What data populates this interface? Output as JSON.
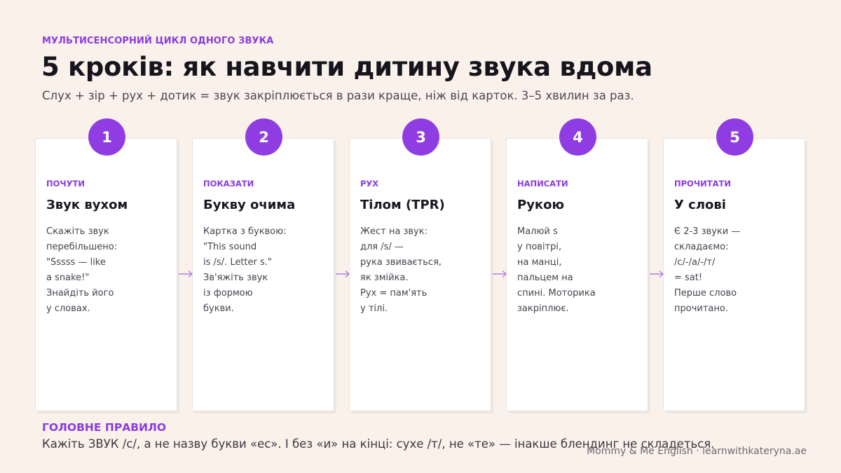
{
  "header": {
    "eyebrow": "МУЛЬТИСЕНСОРНИЙ ЦИКЛ ОДНОГО ЗВУКА",
    "title": "5 кроків: як навчити дитину звука вдома",
    "subtitle": "Слух + зір + рух + дотик = звук закріплюється в рази краще, ніж від карток. 3–5 хвилин за раз."
  },
  "steps": [
    {
      "number": "1",
      "label": "ПОЧУТИ",
      "title": "Звук вухом",
      "text": "Скажіть звук\nперебільшено:\n\"Sssss — like\na snake!\"\nЗнайдіть його\nу словах."
    },
    {
      "number": "2",
      "label": "ПОКАЗАТИ",
      "title": "Букву очима",
      "text": "Картка з буквою:\n\"This sound\nis /s/. Letter s.\"\nЗв'яжіть звук\nіз формою\nбукви."
    },
    {
      "number": "3",
      "label": "РУХ",
      "title": "Тілом (TPR)",
      "text": "Жест на звук:\nдля /s/ —\nрука звивається,\nяк змійка.\nРух = пам'ять\nу тілі."
    },
    {
      "number": "4",
      "label": "НАПИСАТИ",
      "title": "Рукою",
      "text": "Малюй s\nу повітрі,\nна манці,\nпальцем на\nспині. Моторика\nзакріплює."
    },
    {
      "number": "5",
      "label": "ПРОЧИТАТИ",
      "title": "У слові",
      "text": "Є 2-3 звуки —\nскладаємо:\n/с/-/а/-/т/\n= sat!\nПерше слово\nпрочитано."
    }
  ],
  "rule": {
    "heading": "ГОЛОВНЕ ПРАВИЛО",
    "text": "Кажіть ЗВУК /с/, а не назву букви «ес». І без «и» на кінці: сухе /т/, не «те» — інакше блендинг не складеться."
  },
  "footer": "Mommy & Me English · learnwithkateryna.ae",
  "colors": {
    "accent": "#8f3de2",
    "background": "#faf2ea",
    "card": "#ffffff"
  }
}
